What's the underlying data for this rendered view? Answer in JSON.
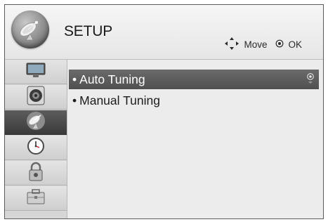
{
  "header": {
    "title": "SETUP",
    "icon": "satellite-dish-icon",
    "hints": [
      {
        "icon": "four-way-arrows-icon",
        "label": "Move"
      },
      {
        "icon": "ok-button-icon",
        "label": "OK"
      }
    ]
  },
  "sidebar": {
    "items": [
      {
        "name": "picture",
        "icon": "tv-icon",
        "active": false
      },
      {
        "name": "audio",
        "icon": "speaker-icon",
        "active": false
      },
      {
        "name": "setup",
        "icon": "satellite-dish-icon",
        "active": true
      },
      {
        "name": "time",
        "icon": "clock-icon",
        "active": false
      },
      {
        "name": "lock",
        "icon": "padlock-icon",
        "active": false
      },
      {
        "name": "option",
        "icon": "toolbox-icon",
        "active": false
      }
    ]
  },
  "menu": {
    "bullet": "•",
    "items": [
      {
        "label": "Auto Tuning",
        "selected": true
      },
      {
        "label": "Manual Tuning",
        "selected": false
      }
    ]
  },
  "colors": {
    "selected_bg": "#5c5c5c",
    "active_sidebar_bg": "#444444",
    "panel_bg": "#ececec"
  }
}
